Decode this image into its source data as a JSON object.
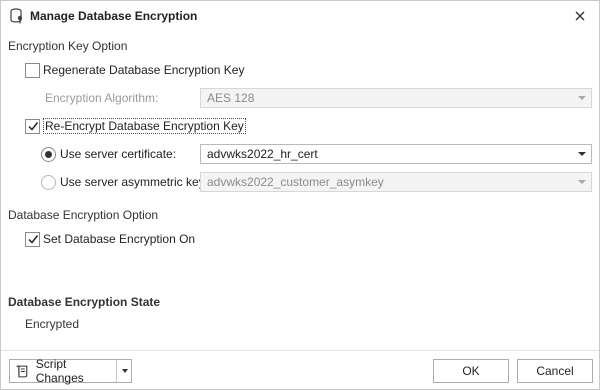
{
  "window": {
    "title": "Manage Database Encryption",
    "icon": "database-key-icon"
  },
  "key_section": {
    "heading": "Encryption Key Option",
    "regenerate": {
      "label": "Regenerate Database Encryption Key",
      "checked": false
    },
    "algorithm": {
      "label": "Encryption Algorithm:",
      "value": "AES 128",
      "enabled": false
    },
    "reencrypt": {
      "label": "Re-Encrypt Database Encryption Key",
      "checked": true
    },
    "server_certificate": {
      "label": "Use server certificate:",
      "value": "advwks2022_hr_cert",
      "selected": true
    },
    "asymmetric_key": {
      "label": "Use server asymmetric key:",
      "value": "advwks2022_customer_asymkey",
      "selected": false,
      "enabled": false
    }
  },
  "db_option_section": {
    "heading": "Database Encryption Option",
    "set_on": {
      "label": "Set Database Encryption On",
      "checked": true
    }
  },
  "state_section": {
    "heading": "Database Encryption State",
    "value": "Encrypted"
  },
  "footer": {
    "script_changes_label": "Script Changes",
    "ok_label": "OK",
    "cancel_label": "Cancel"
  }
}
